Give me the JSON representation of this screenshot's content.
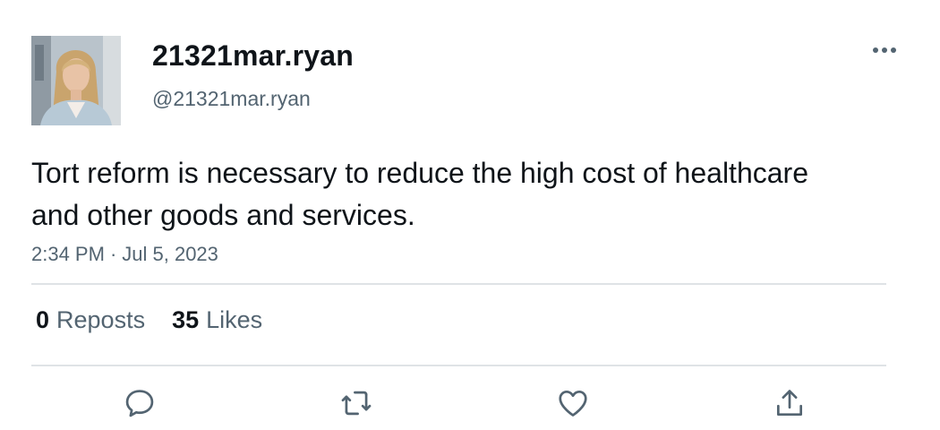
{
  "tweet": {
    "author": {
      "display_name": "21321mar.ryan",
      "handle": "@21321mar.ryan",
      "avatar_icon": "profile-photo"
    },
    "text": "Tort reform is necessary to reduce the high cost of healthcare and other goods and services.",
    "time": "2:34 PM",
    "separator": "·",
    "date": "Jul 5, 2023",
    "stats": {
      "reposts_count": "0",
      "reposts_label": "Reposts",
      "likes_count": "35",
      "likes_label": "Likes"
    },
    "actions": [
      "reply-icon",
      "repost-icon",
      "like-icon",
      "share-icon"
    ],
    "menu_icon": "more-icon"
  },
  "colors": {
    "text_primary": "#0f1419",
    "text_secondary": "#536471",
    "divider": "#dfe3e6",
    "icon": "#536471"
  }
}
